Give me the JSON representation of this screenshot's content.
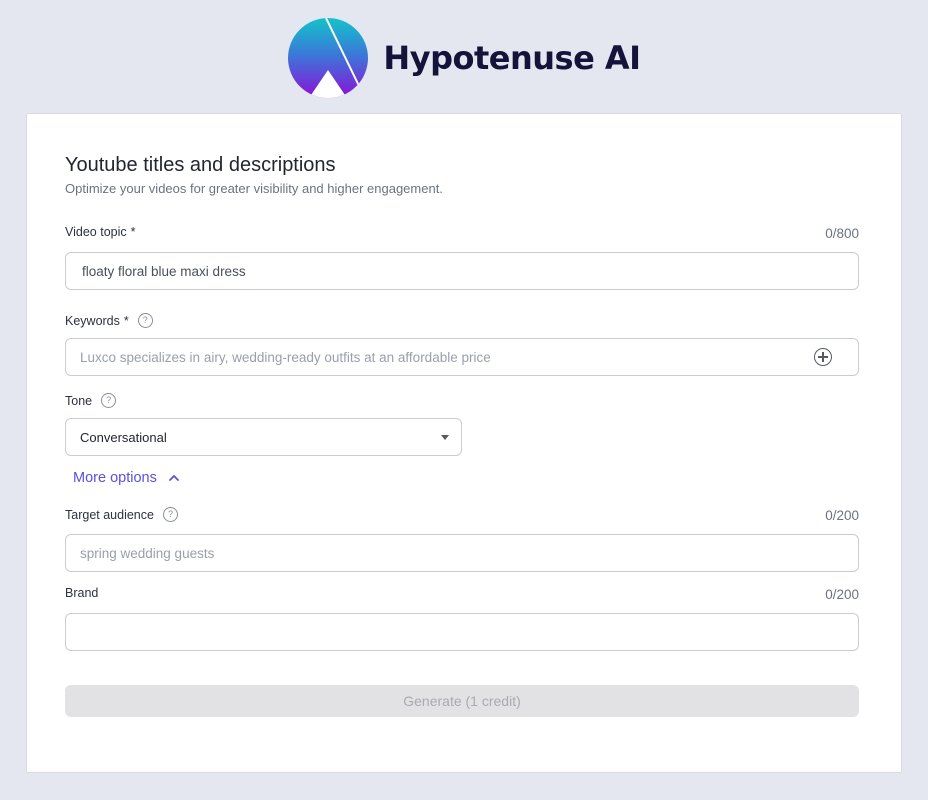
{
  "brand": {
    "name": "Hypotenuse AI",
    "logo_icon": "hypotenuse-logo-icon"
  },
  "form": {
    "title": "Youtube titles and descriptions",
    "subtitle": "Optimize your videos for greater visibility and higher engagement.",
    "video_topic": {
      "label": "Video topic",
      "required_mark": "*",
      "counter": "0/800",
      "value": "floaty floral blue maxi dress"
    },
    "keywords": {
      "label": "Keywords",
      "required_mark": "*",
      "help_icon": "question-circle-icon",
      "help_glyph": "?",
      "placeholder": "Luxco specializes in airy, wedding-ready outfits at an affordable price",
      "add_icon": "plus-circle-icon"
    },
    "tone": {
      "label": "Tone",
      "help_icon": "question-circle-icon",
      "help_glyph": "?",
      "selected": "Conversational",
      "dropdown_icon": "caret-down-icon"
    },
    "more_options": {
      "label": "More options",
      "icon": "chevron-up-icon"
    },
    "target_audience": {
      "label": "Target audience",
      "help_icon": "question-circle-icon",
      "help_glyph": "?",
      "counter": "0/200",
      "placeholder": "spring wedding guests"
    },
    "brand_field": {
      "label": "Brand",
      "counter": "0/200",
      "value": ""
    },
    "generate_button": {
      "label": "Generate (1 credit)"
    }
  },
  "colors": {
    "page_background": "#e4e6f0",
    "accent": "#5b50e0",
    "brand_text": "#14143a",
    "disabled_button": "#e2e2e4",
    "disabled_text": "#a9abb2"
  }
}
